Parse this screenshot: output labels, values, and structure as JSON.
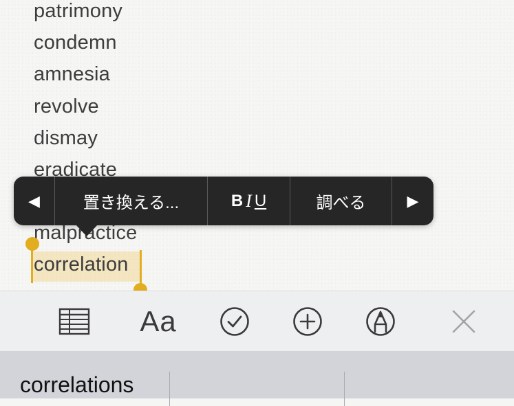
{
  "note": {
    "words": [
      "patrimony",
      "condemn",
      "amnesia",
      "revolve",
      "dismay",
      "eradicate",
      "malpractice",
      "correlation"
    ],
    "selected_word": "correlation"
  },
  "edit_menu": {
    "prev_glyph": "◀",
    "replace_label": "置き換える...",
    "bold_label": "B",
    "italic_label": "I",
    "underline_label": "U",
    "lookup_label": "調べる",
    "next_glyph": "▶"
  },
  "toolbar": {
    "table_icon": "table-icon",
    "format_label": "Aa",
    "checklist_icon": "checklist-icon",
    "add_icon": "plus-circle-icon",
    "markup_icon": "markup-pen-icon",
    "close_icon": "close-icon"
  },
  "predictive": {
    "suggestions": [
      "correlations",
      "",
      ""
    ]
  },
  "colors": {
    "selection": "#e3ad20",
    "menu_bg": "#262626",
    "toolbar_bg": "#eeeff1",
    "predictive_bg": "#d2d4d9"
  }
}
